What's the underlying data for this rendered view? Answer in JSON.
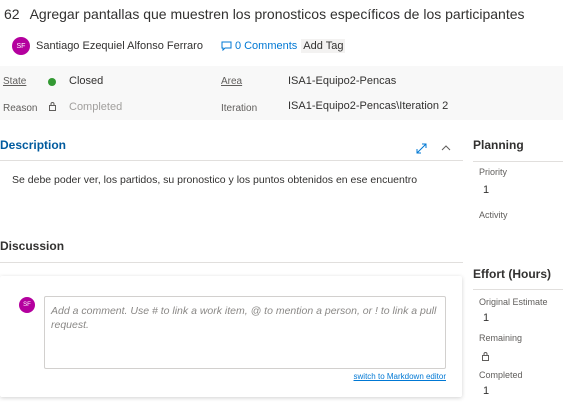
{
  "work_item": {
    "id": "62",
    "title": "Agregar pantallas que muestren los pronosticos específicos de los participantes"
  },
  "owner": {
    "initials": "SF",
    "name": "Santiago Ezequiel Alfonso Ferraro"
  },
  "comments_link": "0 Comments",
  "add_tag": "Add Tag",
  "fields": {
    "state_label": "State",
    "state_value": "Closed",
    "state_color": "#339933",
    "reason_label": "Reason",
    "reason_value": "Completed",
    "area_label": "Area",
    "area_value": "ISA1-Equipo2-Pencas",
    "iteration_label": "Iteration",
    "iteration_value": "ISA1-Equipo2-Pencas\\Iteration 2"
  },
  "description": {
    "title": "Description",
    "text": "Se debe poder ver, los partidos, su pronostico y los puntos obtenidos en ese encuentro"
  },
  "discussion": {
    "title": "Discussion",
    "avatar_initials": "SF",
    "placeholder": "Add a comment. Use # to link a work item, @ to mention a person, or ! to link a pull request.",
    "markdown_link": "switch to Markdown editor"
  },
  "planning": {
    "title": "Planning",
    "priority_label": "Priority",
    "priority_value": "1",
    "activity_label": "Activity"
  },
  "effort": {
    "title": "Effort (Hours)",
    "original_estimate_label": "Original Estimate",
    "original_estimate_value": "1",
    "remaining_label": "Remaining",
    "completed_label": "Completed",
    "completed_value": "1"
  },
  "colors": {
    "accent": "#0078d4",
    "avatar": "#b4009e",
    "section_title": "#005a9e"
  }
}
